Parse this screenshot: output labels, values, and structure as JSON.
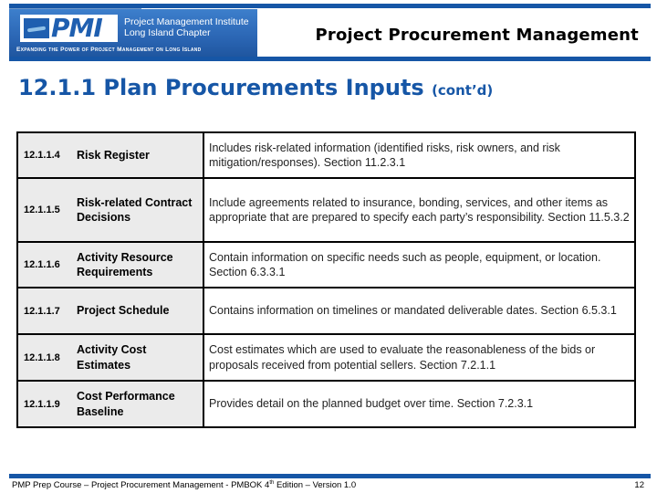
{
  "header": {
    "logo": {
      "mark": "PMI",
      "org_line1": "Project Management Institute",
      "org_line2": "Long Island Chapter",
      "tagline": "Expanding the Power of Project Management on Long Island"
    },
    "title": "Project Procurement Management"
  },
  "slide": {
    "title": "12.1.1 Plan Procurements Inputs",
    "title_suffix": "(cont’d)"
  },
  "rows": [
    {
      "code": "12.1.1.4",
      "name": "Risk Register",
      "description": "Includes risk-related information (identified risks, risk owners, and risk mitigation/responses).  Section 11.2.3.1"
    },
    {
      "code": "12.1.1.5",
      "name": "Risk-related Contract Decisions",
      "description": "Include agreements related to insurance, bonding, services, and other items as appropriate that are prepared to specify each party’s responsibility. Section 11.5.3.2"
    },
    {
      "code": "12.1.1.6",
      "name": "Activity Resource Requirements",
      "description": "Contain information on specific needs such as people, equipment, or location.  Section 6.3.3.1"
    },
    {
      "code": "12.1.1.7",
      "name": "Project Schedule",
      "description": "Contains information on timelines or mandated deliverable dates.  Section 6.5.3.1"
    },
    {
      "code": "12.1.1.8",
      "name": "Activity Cost Estimates",
      "description": "Cost estimates which are used to evaluate the reasonableness of the bids or proposals received from potential sellers.  Section 7.2.1.1"
    },
    {
      "code": "12.1.1.9",
      "name": "Cost Performance Baseline",
      "description": "Provides detail on the planned budget over time.  Section 7.2.3.1"
    }
  ],
  "footer": {
    "text_before": "PMP Prep Course – Project Procurement Management - PMBOK 4",
    "text_sup": "th",
    "text_after": " Edition – Version 1.0",
    "page_number": "12"
  },
  "colors": {
    "accent": "#1656a6",
    "label_cell_bg": "#ebebeb"
  }
}
